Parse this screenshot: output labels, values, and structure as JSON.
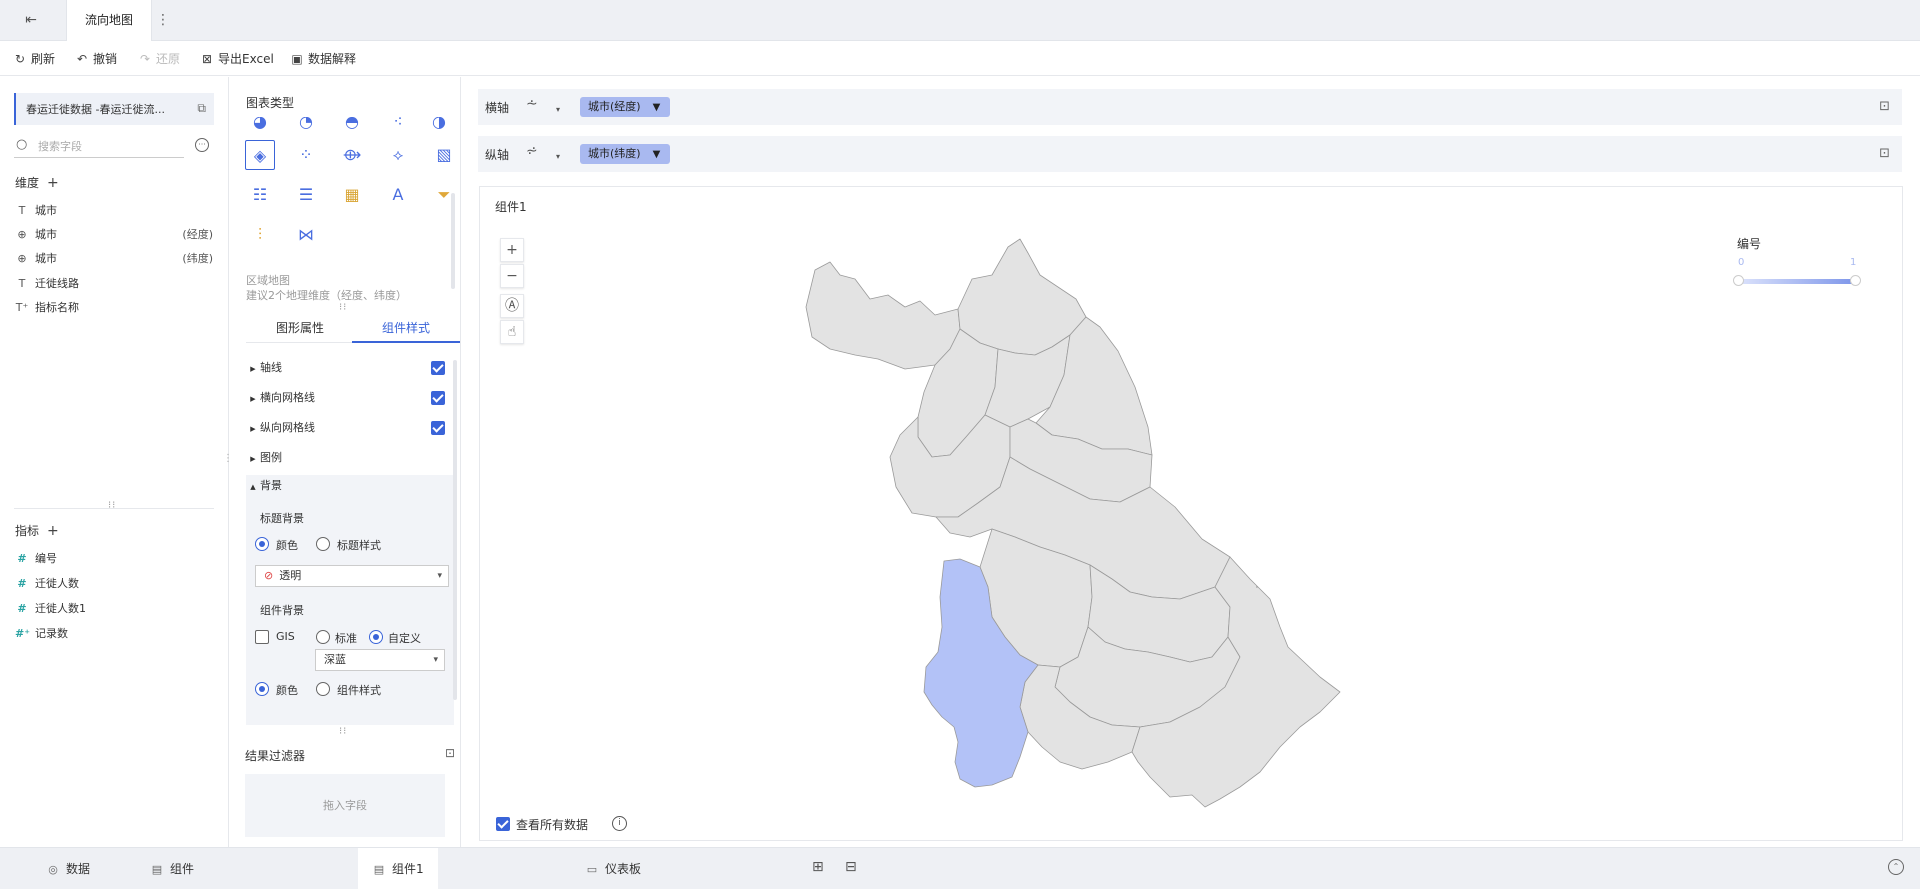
{
  "topbar": {
    "tab_title": "流向地图",
    "back_icon": "exit-icon",
    "more_icon": "more-vertical-icon"
  },
  "toolbar": {
    "refresh": "刷新",
    "undo": "撤销",
    "redo": "还原",
    "export_excel": "导出Excel",
    "data_explain": "数据解释"
  },
  "left": {
    "dataset": "春运迁徙数据 -春运迁徙流...",
    "search_placeholder": "搜索字段",
    "dimension_title": "维度",
    "dimensions": [
      {
        "icon": "T",
        "label": "城市",
        "sub": ""
      },
      {
        "icon": "globe",
        "label": "城市",
        "sub": "(经度)"
      },
      {
        "icon": "globe",
        "label": "城市",
        "sub": "(纬度)"
      },
      {
        "icon": "T",
        "label": "迁徙线路",
        "sub": ""
      },
      {
        "icon": "T+",
        "label": "指标名称",
        "sub": ""
      }
    ],
    "measure_title": "指标",
    "measures": [
      {
        "icon": "#",
        "label": "编号"
      },
      {
        "icon": "#",
        "label": "迁徙人数"
      },
      {
        "icon": "#",
        "label": "迁徙人数1"
      },
      {
        "icon": "#+",
        "label": "记录数"
      }
    ]
  },
  "chart_panel": {
    "title": "图表类型",
    "selected_type": "区域地图",
    "hint": "建议2个地理维度（经度、纬度）",
    "tabs": [
      "图形属性",
      "组件样式"
    ],
    "active_tab": "组件样式",
    "props": [
      {
        "label": "轴线",
        "checked": true
      },
      {
        "label": "横向网格线",
        "checked": true
      },
      {
        "label": "纵向网格线",
        "checked": true
      },
      {
        "label": "图例",
        "checked": null
      },
      {
        "label": "背景",
        "checked": null
      }
    ],
    "background": {
      "title_bg_label": "标题背景",
      "title_bg_opt_color": "颜色",
      "title_bg_opt_style": "标题样式",
      "title_bg_value": "透明",
      "comp_bg_label": "组件背景",
      "gis_label": "GIS",
      "std_label": "标准",
      "custom_label": "自定义",
      "custom_value": "深蓝",
      "comp_opt_color": "颜色",
      "comp_opt_style": "组件样式"
    },
    "filter_title": "结果过滤器",
    "filter_drop": "拖入字段"
  },
  "axes": {
    "x_label": "横轴",
    "x_field": "城市(经度)",
    "y_label": "纵轴",
    "y_field": "城市(纬度)"
  },
  "canvas": {
    "component_title": "组件1",
    "legend": {
      "title": "编号",
      "min": "0",
      "max": "1",
      "color_low": "#dbe2fb",
      "color_high": "#7f97ea"
    },
    "view_all": "查看所有数据",
    "highlight_color": "#b3c2f7",
    "region_color": "#e3e3e3"
  },
  "bottombar": {
    "tabs": [
      {
        "label": "数据",
        "active": false
      },
      {
        "label": "组件",
        "active": false
      },
      {
        "label": "组件1",
        "active": true
      },
      {
        "label": "仪表板",
        "active": false
      }
    ]
  }
}
